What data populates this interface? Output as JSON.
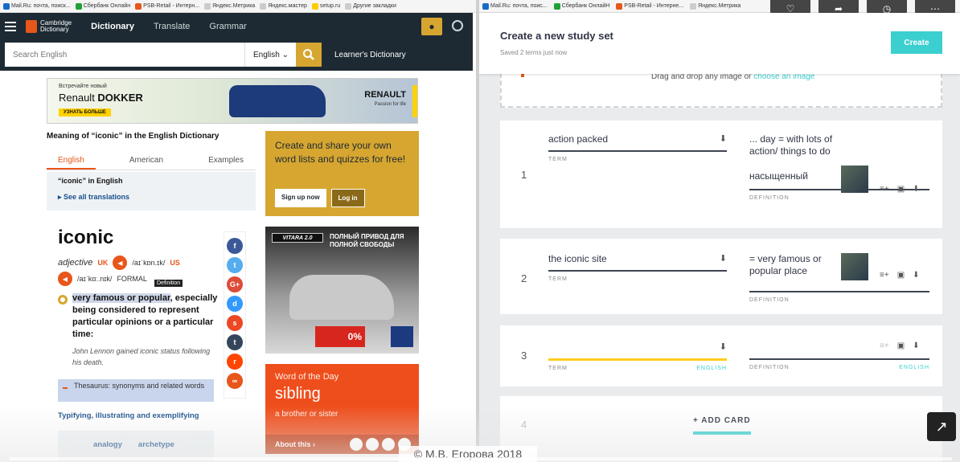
{
  "bookmarks_left": [
    "Mail.Ru: почта, поиск...",
    "Сбербанк Онлайн",
    "PSB-Retail - Интерн...",
    "Яндекс.Метрика",
    "Яндекс.мастер",
    "setup.ru",
    "Другие закладки"
  ],
  "bookmarks_right": [
    "Mail.Ru: почта, поис...",
    "Сбербанк ОнлайН",
    "PSB-Retail - Интерне...",
    "Яндекс.Метрика"
  ],
  "cambridge": {
    "logo_line1": "Cambridge",
    "logo_line2": "Dictionary",
    "nav": [
      "Dictionary",
      "Translate",
      "Grammar"
    ],
    "search_placeholder": "Search English",
    "language": "English",
    "learners": "Learner's Dictionary"
  },
  "ad_banner": {
    "line1": "Встречайте новый",
    "line2_a": "Renault ",
    "line2_b": "DOKKER",
    "cta": "УЗНАТЬ БОЛЬШЕ",
    "brand": "RENAULT",
    "tagline": "Passion for life"
  },
  "entry": {
    "meaning_heading": "Meaning of “iconic” in the English Dictionary",
    "tabs": [
      "English",
      "American",
      "Examples"
    ],
    "translation_heading": "“iconic” in English",
    "see_all": "▸ See all translations",
    "headword": "iconic",
    "pos": "adjective",
    "uk_label": "UK",
    "uk_ipa": "/aɪˈkɒn.ɪk/",
    "us_label": "US",
    "us_ipa": "/aɪˈkɑː.nɪk/",
    "formal": "FORMAL",
    "tooltip": "Definition",
    "definition_highlight": "very famous or popular",
    "definition_rest": ", especially being considered to represent particular opinions or a particular time:",
    "example": "John Lennon gained iconic status following his death.",
    "thesaurus": "Thesaurus: synonyms and related words",
    "typifying": "Typifying, illustrating and exemplifying",
    "synonyms": [
      "analogy",
      "archetype"
    ]
  },
  "share_icons": [
    {
      "name": "facebook",
      "glyph": "f",
      "color": "#3b5998"
    },
    {
      "name": "twitter",
      "glyph": "t",
      "color": "#55acee"
    },
    {
      "name": "google-plus",
      "glyph": "G+",
      "color": "#dd4b39"
    },
    {
      "name": "delicious",
      "glyph": "d",
      "color": "#3399ff"
    },
    {
      "name": "stumbleupon",
      "glyph": "s",
      "color": "#eb4823"
    },
    {
      "name": "tumblr",
      "glyph": "t",
      "color": "#35465c"
    },
    {
      "name": "reddit",
      "glyph": "r",
      "color": "#ff4500"
    },
    {
      "name": "link",
      "glyph": "∞",
      "color": "#e8561a"
    }
  ],
  "promo": {
    "text": "Create and share your own word lists and quizzes for free!",
    "signup": "Sign up now",
    "login": "Log in"
  },
  "ad_car": {
    "badge": "VITARA 2.0",
    "headline": "ПОЛНЫЙ ПРИВОД ДЛЯ ПОЛНОЙ СВОБОДЫ",
    "offer": "0%"
  },
  "wotd": {
    "title": "Word of the Day",
    "word": "sibling",
    "definition": "a brother or sister",
    "about": "About this ›"
  },
  "quizlet": {
    "title": "Create a new study set",
    "subtitle": "Saved 2 terms just now",
    "create": "Create",
    "drop_text": "Drag and drop any image or ",
    "drop_link": "choose an image",
    "term_label": "TERM",
    "definition_label": "DEFINITION",
    "english_label": "ENGLISH",
    "cards": [
      {
        "num": "1",
        "term": "action packed",
        "definition": "... day = with lots of action/ things to do",
        "translation": "насыщенный"
      },
      {
        "num": "2",
        "term": "the iconic site",
        "definition": "= very famous or popular place",
        "translation": ""
      },
      {
        "num": "3",
        "term": "",
        "definition": "",
        "translation": ""
      }
    ],
    "add_card_num": "4",
    "add_card": "+ ADD CARD"
  },
  "watermark": "© М.В. Егорова 2018"
}
